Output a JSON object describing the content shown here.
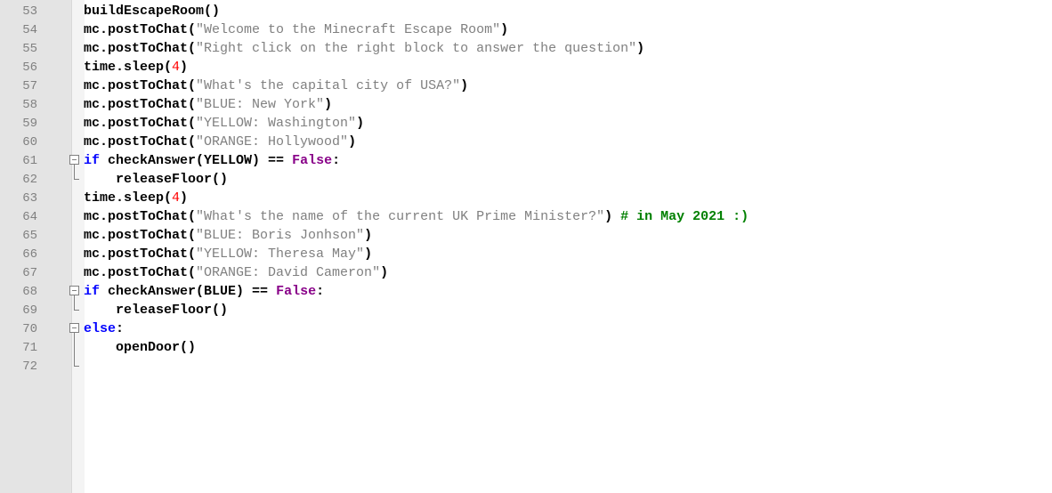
{
  "editor": {
    "lines": [
      {
        "number": "53",
        "indent": "",
        "tokens": [
          {
            "type": "default",
            "text": "buildEscapeRoom()"
          }
        ]
      },
      {
        "number": "54",
        "indent": "",
        "tokens": [
          {
            "type": "default",
            "text": "mc.postToChat("
          },
          {
            "type": "string",
            "text": "\"Welcome to the Minecraft Escape Room\""
          },
          {
            "type": "default",
            "text": ")"
          }
        ]
      },
      {
        "number": "55",
        "indent": "",
        "tokens": [
          {
            "type": "default",
            "text": "mc.postToChat("
          },
          {
            "type": "string",
            "text": "\"Right click on the right block to answer the question\""
          },
          {
            "type": "default",
            "text": ")"
          }
        ]
      },
      {
        "number": "56",
        "indent": "",
        "tokens": [
          {
            "type": "default",
            "text": "time.sleep("
          },
          {
            "type": "number",
            "text": "4"
          },
          {
            "type": "default",
            "text": ")"
          }
        ]
      },
      {
        "number": "57",
        "indent": "",
        "tokens": [
          {
            "type": "default",
            "text": "mc.postToChat("
          },
          {
            "type": "string",
            "text": "\"What's the capital city of USA?\""
          },
          {
            "type": "default",
            "text": ")"
          }
        ]
      },
      {
        "number": "58",
        "indent": "",
        "tokens": [
          {
            "type": "default",
            "text": "mc.postToChat("
          },
          {
            "type": "string",
            "text": "\"BLUE: New York\""
          },
          {
            "type": "default",
            "text": ")"
          }
        ]
      },
      {
        "number": "59",
        "indent": "",
        "tokens": [
          {
            "type": "default",
            "text": "mc.postToChat("
          },
          {
            "type": "string",
            "text": "\"YELLOW: Washington\""
          },
          {
            "type": "default",
            "text": ")"
          }
        ]
      },
      {
        "number": "60",
        "indent": "",
        "tokens": [
          {
            "type": "default",
            "text": "mc.postToChat("
          },
          {
            "type": "string",
            "text": "\"ORANGE: Hollywood\""
          },
          {
            "type": "default",
            "text": ")"
          }
        ]
      },
      {
        "number": "61",
        "indent": "",
        "fold": "start",
        "tokens": [
          {
            "type": "keyword",
            "text": "if"
          },
          {
            "type": "default",
            "text": " checkAnswer(YELLOW) == "
          },
          {
            "type": "constant",
            "text": "False"
          },
          {
            "type": "default",
            "text": ":"
          }
        ]
      },
      {
        "number": "62",
        "indent": "    ",
        "fold": "end",
        "tokens": [
          {
            "type": "default",
            "text": "releaseFloor()"
          }
        ]
      },
      {
        "number": "63",
        "indent": "",
        "tokens": [
          {
            "type": "default",
            "text": "time.sleep("
          },
          {
            "type": "number",
            "text": "4"
          },
          {
            "type": "default",
            "text": ")"
          }
        ]
      },
      {
        "number": "64",
        "indent": "",
        "tokens": [
          {
            "type": "default",
            "text": "mc.postToChat("
          },
          {
            "type": "string",
            "text": "\"What's the name of the current UK Prime Minister?\""
          },
          {
            "type": "default",
            "text": ") "
          },
          {
            "type": "comment",
            "text": "# in May 2021 :)"
          }
        ]
      },
      {
        "number": "65",
        "indent": "",
        "tokens": [
          {
            "type": "default",
            "text": "mc.postToChat("
          },
          {
            "type": "string",
            "text": "\"BLUE: Boris Jonhson\""
          },
          {
            "type": "default",
            "text": ")"
          }
        ]
      },
      {
        "number": "66",
        "indent": "",
        "tokens": [
          {
            "type": "default",
            "text": "mc.postToChat("
          },
          {
            "type": "string",
            "text": "\"YELLOW: Theresa May\""
          },
          {
            "type": "default",
            "text": ")"
          }
        ]
      },
      {
        "number": "67",
        "indent": "",
        "tokens": [
          {
            "type": "default",
            "text": "mc.postToChat("
          },
          {
            "type": "string",
            "text": "\"ORANGE: David Cameron\""
          },
          {
            "type": "default",
            "text": ")"
          }
        ]
      },
      {
        "number": "68",
        "indent": "",
        "fold": "start",
        "tokens": [
          {
            "type": "keyword",
            "text": "if"
          },
          {
            "type": "default",
            "text": " checkAnswer(BLUE) == "
          },
          {
            "type": "constant",
            "text": "False"
          },
          {
            "type": "default",
            "text": ":"
          }
        ]
      },
      {
        "number": "69",
        "indent": "    ",
        "fold": "end",
        "tokens": [
          {
            "type": "default",
            "text": "releaseFloor()"
          }
        ]
      },
      {
        "number": "70",
        "indent": "",
        "fold": "start",
        "tokens": [
          {
            "type": "keyword",
            "text": "else"
          },
          {
            "type": "default",
            "text": ":"
          }
        ]
      },
      {
        "number": "71",
        "indent": "    ",
        "fold": "mid",
        "tokens": [
          {
            "type": "default",
            "text": "openDoor()"
          }
        ]
      },
      {
        "number": "72",
        "indent": "",
        "fold": "end",
        "tokens": []
      }
    ]
  }
}
